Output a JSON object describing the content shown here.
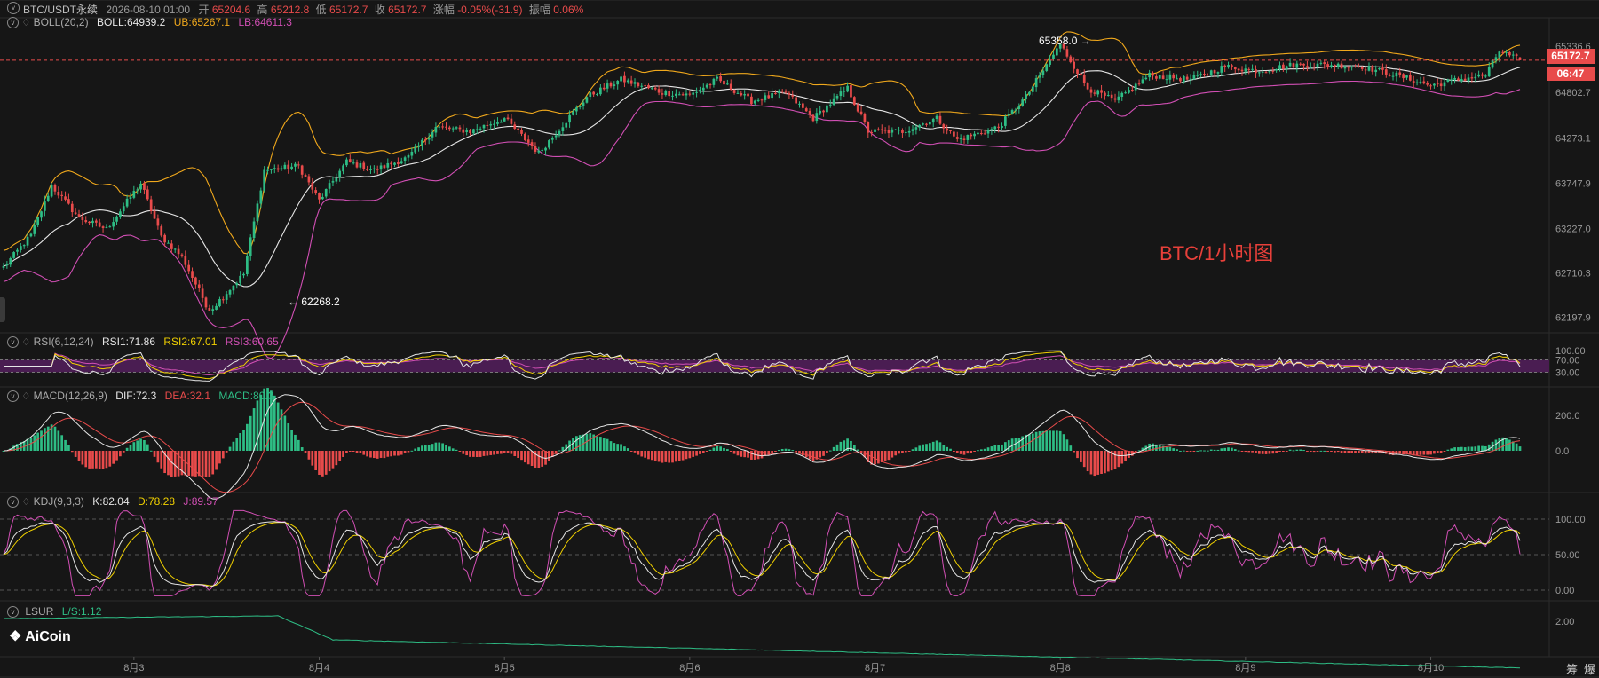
{
  "symbol_info": {
    "symbol": "BTC/USDT永续",
    "time": "2026-08-10 01:00",
    "open_label": "开",
    "open": "65204.6",
    "high_label": "高",
    "high": "65212.8",
    "low_label": "低",
    "low": "65172.7",
    "close_label": "收",
    "close": "65172.7",
    "change_label": "涨幅",
    "change": "-0.05%(-31.9)",
    "amplitude_label": "振幅",
    "amplitude": "0.06%"
  },
  "boll": {
    "name": "BOLL(20,2)",
    "mid": "BOLL:64939.2",
    "ub": "UB:65267.1",
    "lb": "LB:64611.3"
  },
  "rsi": {
    "name": "RSI(6,12,24)",
    "r1": "RSI1:71.86",
    "r2": "RSI2:67.01",
    "r3": "RSI3:60.65"
  },
  "macd": {
    "name": "MACD(12,26,9)",
    "dif": "DIF:72.3",
    "dea": "DEA:32.1",
    "macd": "MACD:80.3"
  },
  "kdj": {
    "name": "KDJ(9,3,3)",
    "k": "K:82.04",
    "d": "D:78.28",
    "j": "J:89.57"
  },
  "lsur": {
    "name": "LSUR",
    "ls": "L/S:1.12"
  },
  "watermark": "BTC/1小时图",
  "logo_text": "AiCoin",
  "last_price": "65172.7",
  "countdown": "06:47",
  "annotations": {
    "high": "65358.0 →",
    "low": "← 62268.2"
  },
  "bottom_right": [
    "筹",
    "爆"
  ],
  "colors": {
    "up": "#2ebd85",
    "down": "#e84b4b",
    "boll_mid": "#e6e6e6",
    "boll_ub": "#f0a81c",
    "boll_lb": "#d14fb4",
    "bg": "#161616",
    "watermark": "#e8403a"
  },
  "chart_data": [
    {
      "type": "candlestick",
      "title": "BTC/USDT永续 1小时",
      "x_labels": [
        "8月3",
        "8月4",
        "8月5",
        "8月6",
        "8月7",
        "8月8",
        "8月9",
        "8月10"
      ],
      "y_ticks": [
        "65336.6",
        "64802.7",
        "64273.1",
        "63747.9",
        "63227.0",
        "62710.3",
        "62197.9"
      ],
      "ylim": [
        62050,
        65480
      ],
      "anchors": [
        [
          0,
          62780
        ],
        [
          8,
          63150
        ],
        [
          14,
          63720
        ],
        [
          22,
          63350
        ],
        [
          30,
          63220
        ],
        [
          40,
          63750
        ],
        [
          46,
          63130
        ],
        [
          52,
          62900
        ],
        [
          60,
          62268
        ],
        [
          70,
          62700
        ],
        [
          76,
          63900
        ],
        [
          86,
          63950
        ],
        [
          92,
          63550
        ],
        [
          100,
          64000
        ],
        [
          108,
          63900
        ],
        [
          118,
          64050
        ],
        [
          126,
          64400
        ],
        [
          136,
          64350
        ],
        [
          146,
          64500
        ],
        [
          156,
          64100
        ],
        [
          170,
          64750
        ],
        [
          180,
          64950
        ],
        [
          192,
          64800
        ],
        [
          200,
          64770
        ],
        [
          208,
          64950
        ],
        [
          218,
          64700
        ],
        [
          228,
          64800
        ],
        [
          236,
          64500
        ],
        [
          246,
          64850
        ],
        [
          252,
          64350
        ],
        [
          262,
          64350
        ],
        [
          272,
          64500
        ],
        [
          278,
          64250
        ],
        [
          290,
          64400
        ],
        [
          298,
          64750
        ],
        [
          308,
          65358
        ],
        [
          316,
          64850
        ],
        [
          324,
          64700
        ],
        [
          334,
          65000
        ],
        [
          346,
          64950
        ],
        [
          356,
          65100
        ],
        [
          366,
          65050
        ],
        [
          376,
          65120
        ],
        [
          386,
          65120
        ],
        [
          396,
          65100
        ],
        [
          406,
          65000
        ],
        [
          416,
          64880
        ],
        [
          424,
          64950
        ],
        [
          432,
          65000
        ],
        [
          436,
          65280
        ],
        [
          442,
          65172.7
        ]
      ]
    },
    {
      "type": "line",
      "title": "RSI",
      "y_ticks": [
        "100.00",
        "70.00",
        "30.00"
      ],
      "ylim": [
        0,
        100
      ],
      "last": [
        71.86,
        67.01,
        60.65
      ]
    },
    {
      "type": "bar+line",
      "title": "MACD",
      "y_ticks": [
        "200.0",
        "0.0"
      ],
      "last": {
        "dif": 72.3,
        "dea": 32.1,
        "macd": 80.3
      }
    },
    {
      "type": "line",
      "title": "KDJ",
      "y_ticks": [
        "100.00",
        "50.00",
        "0.00"
      ],
      "ylim": [
        -10,
        115
      ],
      "last": {
        "k": 82.04,
        "d": 78.28,
        "j": 89.57
      }
    },
    {
      "type": "line",
      "title": "LSUR",
      "y_ticks": [
        "2.00"
      ],
      "last": 1.12
    }
  ]
}
